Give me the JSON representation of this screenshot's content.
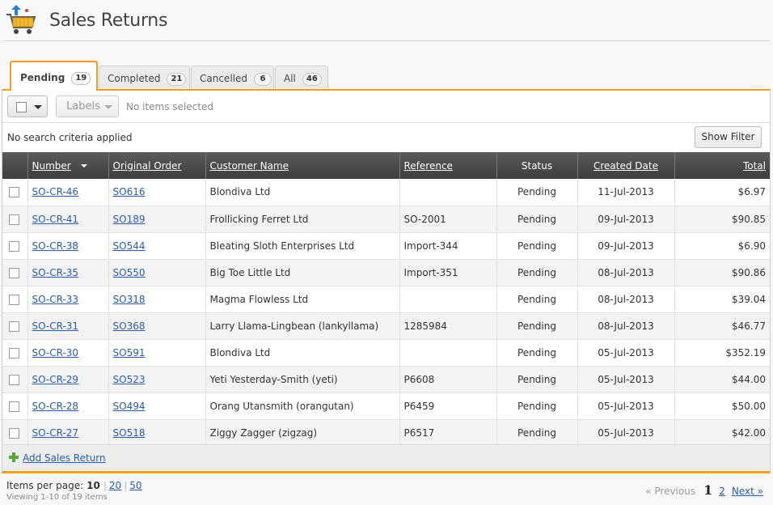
{
  "header": {
    "title": "Sales Returns",
    "icon": "shopping-cart-return-icon"
  },
  "tabs": [
    {
      "label": "Pending",
      "count": "19",
      "active": true
    },
    {
      "label": "Completed",
      "count": "21",
      "active": false
    },
    {
      "label": "Cancelled",
      "count": "6",
      "active": false
    },
    {
      "label": "All",
      "count": "46",
      "active": false
    }
  ],
  "toolbar": {
    "labels_button": "Labels",
    "selection_status": "No items selected"
  },
  "filter": {
    "criteria_text": "No search criteria applied",
    "show_filter_label": "Show Filter"
  },
  "table": {
    "columns": [
      "Number",
      "Original Order",
      "Customer Name",
      "Reference",
      "Status",
      "Created Date",
      "Total"
    ],
    "rows": [
      {
        "number": "SO-CR-46",
        "order": "SO616",
        "customer": "Blondiva Ltd",
        "reference": "",
        "status": "Pending",
        "date": "11-Jul-2013",
        "total": "$6.97"
      },
      {
        "number": "SO-CR-41",
        "order": "SO189",
        "customer": "Frollicking Ferret Ltd",
        "reference": "SO-2001",
        "status": "Pending",
        "date": "09-Jul-2013",
        "total": "$90.85"
      },
      {
        "number": "SO-CR-38",
        "order": "SO544",
        "customer": "Bleating Sloth Enterprises Ltd",
        "reference": "Import-344",
        "status": "Pending",
        "date": "09-Jul-2013",
        "total": "$6.90"
      },
      {
        "number": "SO-CR-35",
        "order": "SO550",
        "customer": "Big Toe Little Ltd",
        "reference": "Import-351",
        "status": "Pending",
        "date": "08-Jul-2013",
        "total": "$90.86"
      },
      {
        "number": "SO-CR-33",
        "order": "SO318",
        "customer": "Magma Flowless Ltd",
        "reference": "",
        "status": "Pending",
        "date": "08-Jul-2013",
        "total": "$39.04"
      },
      {
        "number": "SO-CR-31",
        "order": "SO368",
        "customer": "Larry Llama-Lingbean (lankyllama)",
        "reference": "1285984",
        "status": "Pending",
        "date": "08-Jul-2013",
        "total": "$46.77"
      },
      {
        "number": "SO-CR-30",
        "order": "SO591",
        "customer": "Blondiva Ltd",
        "reference": "",
        "status": "Pending",
        "date": "05-Jul-2013",
        "total": "$352.19"
      },
      {
        "number": "SO-CR-29",
        "order": "SO523",
        "customer": "Yeti Yesterday-Smith (yeti)",
        "reference": "P6608",
        "status": "Pending",
        "date": "05-Jul-2013",
        "total": "$44.00"
      },
      {
        "number": "SO-CR-28",
        "order": "SO494",
        "customer": "Orang Utansmith (orangutan)",
        "reference": "P6459",
        "status": "Pending",
        "date": "05-Jul-2013",
        "total": "$50.00"
      },
      {
        "number": "SO-CR-27",
        "order": "SO518",
        "customer": "Ziggy Zagger (zigzag)",
        "reference": "P6517",
        "status": "Pending",
        "date": "05-Jul-2013",
        "total": "$42.00"
      }
    ]
  },
  "add_link": "Add Sales Return",
  "footer": {
    "items_per_page_label": "Items per page:",
    "per_page_current": "10",
    "per_page_options": [
      "20",
      "50"
    ],
    "viewing_text": "Viewing 1-10 of 19 items",
    "prev_label": "« Previous",
    "current_page": "1",
    "page_2": "2",
    "next_label": "Next »"
  }
}
